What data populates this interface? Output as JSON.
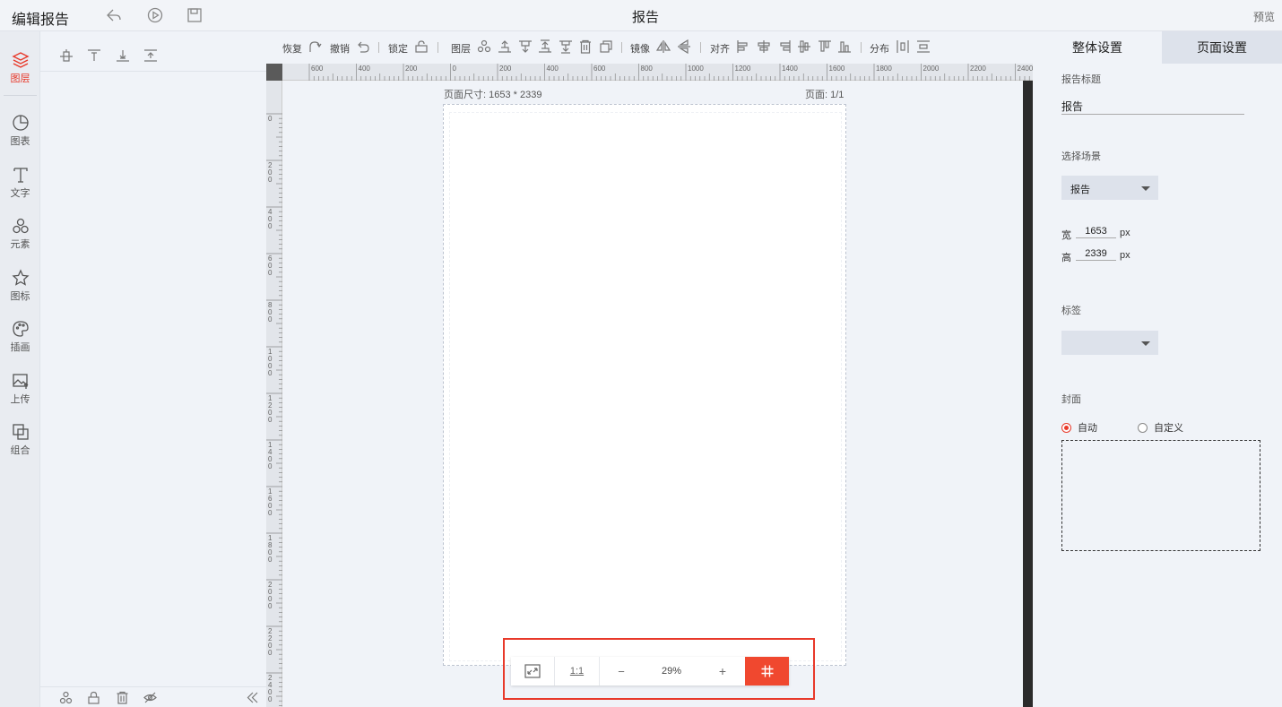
{
  "header": {
    "app_title": "编辑报告",
    "page_title": "报告",
    "preview_label": "预览",
    "icons": [
      "share-icon",
      "play-icon",
      "save-icon"
    ]
  },
  "leftnav": {
    "items": [
      {
        "label": "图层",
        "icon": "layers-icon",
        "active": true
      },
      {
        "label": "图表",
        "icon": "pie-chart-icon"
      },
      {
        "label": "文字",
        "icon": "text-icon"
      },
      {
        "label": "元素",
        "icon": "shapes-icon"
      },
      {
        "label": "图标",
        "icon": "star-icon"
      },
      {
        "label": "插画",
        "icon": "palette-icon"
      },
      {
        "label": "上传",
        "icon": "upload-image-icon"
      },
      {
        "label": "组合",
        "icon": "combine-icon"
      }
    ]
  },
  "layer_panel": {
    "top_tools": [
      "align-vcenter-icon",
      "align-top-icon",
      "align-bottom-icon",
      "bring-up-icon"
    ],
    "bottom_tools": [
      "group-icon",
      "lock-icon",
      "delete-icon",
      "hide-icon",
      "collapse-icon"
    ]
  },
  "toolbar": {
    "redo_label": "恢复",
    "undo_label": "撤销",
    "lock_label": "锁定",
    "layer_label": "图层",
    "mirror_label": "镜像",
    "align_label": "对齐",
    "distribute_label": "分布"
  },
  "ruler": {
    "h_labels": [
      "600",
      "400",
      "200",
      "0",
      "200",
      "400",
      "600",
      "800",
      "1000",
      "1200",
      "1400",
      "1600",
      "1800",
      "2000",
      "2200",
      "2400"
    ],
    "v_labels": [
      "0",
      "200",
      "400",
      "600",
      "800",
      "1000",
      "1200",
      "1400",
      "1600",
      "1800",
      "2000",
      "2200",
      "2400"
    ]
  },
  "canvas": {
    "page_size_label": "页面尺寸: 1653 * 2339",
    "page_num_label": "页面: 1/1"
  },
  "zoom": {
    "ratio_label": "1:1",
    "minus": "−",
    "plus": "+",
    "level": "29%"
  },
  "right_panel": {
    "tabs": [
      "整体设置",
      "页面设置"
    ],
    "active_tab": "页面设置",
    "report_title_label": "报告标题",
    "report_title_value": "报告",
    "scene_label": "选择场景",
    "scene_value": "报告",
    "width_label": "宽",
    "width_value": "1653",
    "height_label": "高",
    "height_value": "2339",
    "unit": "px",
    "tag_label": "标签",
    "tag_value": "",
    "cover_label": "封面",
    "cover_options": [
      "自动",
      "自定义"
    ],
    "cover_selected": "自动"
  },
  "colors": {
    "accent": "#e8392a",
    "grid_button": "#f0482f",
    "background": "#f0f3f8"
  }
}
